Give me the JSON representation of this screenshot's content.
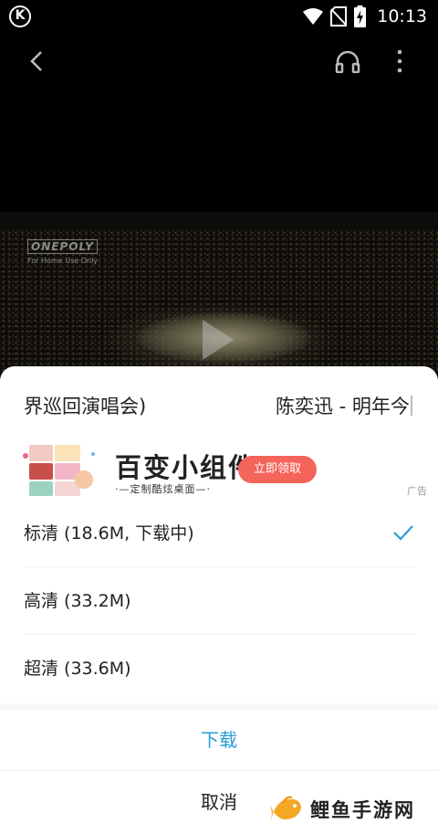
{
  "status_bar": {
    "time": "10:13",
    "app_icon": "K"
  },
  "player": {
    "watermark_title": "ONEPOLY",
    "watermark_sub": "For Home Use Only"
  },
  "sheet": {
    "title_left": "界巡回演唱会)",
    "title_right": "陈奕迅 - 明年今日",
    "ad": {
      "title": "百变小组件",
      "subtitle": "·—定制酷炫桌面—·",
      "button": "立即领取",
      "label": "广告"
    },
    "qualities": [
      {
        "label": "标清 (18.6M, 下载中)",
        "selected": true
      },
      {
        "label": "高清 (33.2M)",
        "selected": false
      },
      {
        "label": "超清 (33.6M)",
        "selected": false
      }
    ],
    "download": "下载",
    "cancel": "取消"
  },
  "site_watermark": {
    "name": "鲤鱼手游网"
  },
  "colors": {
    "accent": "#2a9bd7",
    "ad_button": "#f4645a"
  }
}
